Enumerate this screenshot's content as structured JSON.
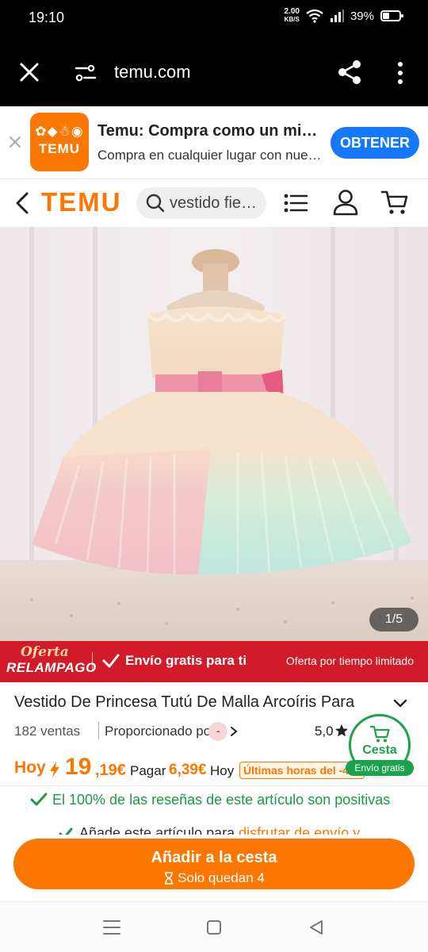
{
  "status_bar": {
    "time": "19:10",
    "net_speed_value": "2.00",
    "net_speed_unit": "KB/S",
    "battery": "39%"
  },
  "browser": {
    "url": "temu.com",
    "icons": [
      "close-icon",
      "site-settings-icon",
      "share-icon",
      "more-vertical-icon"
    ]
  },
  "app_banner": {
    "logo_word": "TEMU",
    "title": "Temu: Compra como un mi…",
    "subtitle": "Compra en cualquier lugar con nue…",
    "get_button": "OBTENER"
  },
  "header": {
    "logo": "TEMU",
    "search_value": "vestido fie…",
    "icons": [
      "back-icon",
      "search-icon",
      "list-icon",
      "user-icon",
      "cart-icon"
    ]
  },
  "gallery": {
    "counter": "1/5"
  },
  "flash": {
    "logo_line1": "Oferta",
    "logo_line2": "RELAMPAGO",
    "shipping": "Envío gratis para ti",
    "offer": "Oferta por tiempo limitado",
    "accent": "#d11a2a"
  },
  "product": {
    "title": "Vestido De Princesa Tutú De Malla Arcoíris Para",
    "sales": "182 ventas",
    "provided_by": "Proporcionado por",
    "rating": "5,0",
    "hoy_label": "Hoy",
    "price_int": "19",
    "price_dec": ",19€",
    "pay_label": "Pagar",
    "pay_amount": "6,39€",
    "pay_today": "Hoy",
    "last_hours": "Últimas horas del -4",
    "brand_color": "#fb7701"
  },
  "floating_cart": {
    "label": "Cesta",
    "shipping": "Envío gratis"
  },
  "reviews": {
    "text": "El 100% de las reseñas de este artículo son positivas",
    "partial_text": "Añade este artículo para ",
    "partial_link": "disfrutar de envío y"
  },
  "cta": {
    "add_to_cart": "Añadir a la cesta",
    "stock": "Solo quedan 4"
  },
  "nav": {
    "icons": [
      "recent-apps-icon",
      "home-icon",
      "back-nav-icon"
    ]
  }
}
